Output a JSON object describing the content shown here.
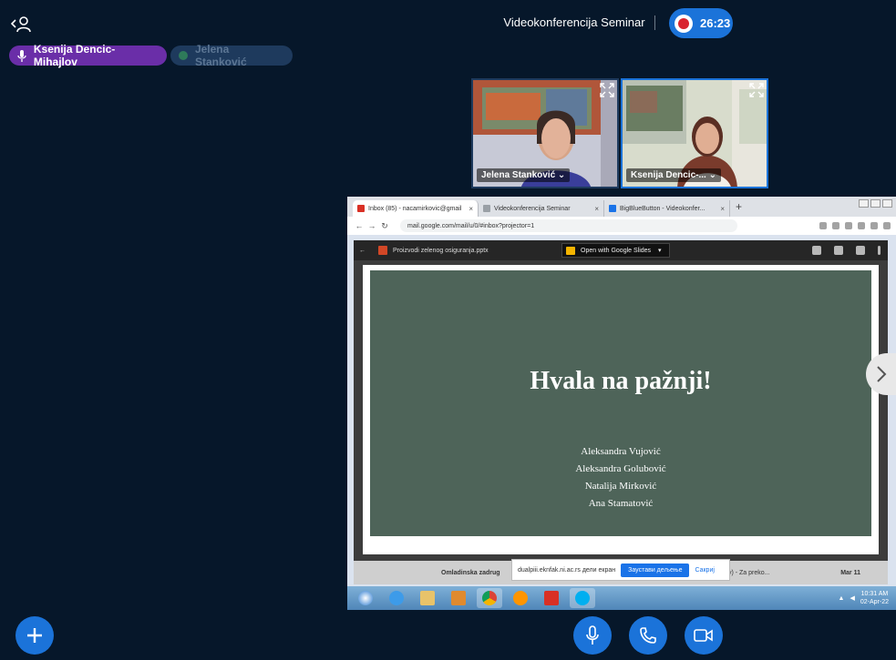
{
  "header": {
    "meeting_title": "Videokonferencija Seminar",
    "recording_time": "26:23"
  },
  "talkers": [
    {
      "name": "Ksenija Dencic-Mihajlov",
      "state": "talking"
    },
    {
      "name": "Jelena Stanković",
      "state": "muted"
    }
  ],
  "webcams": [
    {
      "name": "Jelena Stanković ⌄"
    },
    {
      "name": "Ksenija Dencic-... ⌄"
    }
  ],
  "screenshare": {
    "browser": {
      "tabs": [
        {
          "label": "Inbox (85) - nacamirkovic@gmail",
          "favicon_color": "#d93025"
        },
        {
          "label": "Videokonferencija Seminar",
          "favicon_color": "#9aa0a6"
        },
        {
          "label": "BigBlueButton - Videokonfer...",
          "favicon_color": "#1a73e8"
        }
      ],
      "address": "mail.google.com/mail/u/0/#inbox?projector=1"
    },
    "viewer": {
      "file_name": "Proizvodi zelenog osiguranja.pptx",
      "open_with": "Open with Google Slides"
    },
    "slide": {
      "title": "Hvala na pažnji!",
      "authors": [
        "Aleksandra Vujović",
        "Aleksandra Golubović",
        "Natalija Mirković",
        "Ana Stamatović"
      ]
    },
    "gmail_strip": {
      "sender": "Omladinska zadrug",
      "snippet": "a City) - Za preko...",
      "date": "Mar 11"
    },
    "share_bar": {
      "message": "dualpiii.eknfak.ni.ac.rs дели екран",
      "stop_label": "Заустави дељење",
      "hide_label": "Сакриј"
    },
    "taskbar": {
      "time": "10:31 AM",
      "date": "02-Apr-22"
    }
  },
  "colors": {
    "background": "#06172a",
    "accent": "#1b73d9",
    "talking": "#6a2ea8",
    "slide_bg": "#4e6459",
    "recording": "#d9232e"
  }
}
